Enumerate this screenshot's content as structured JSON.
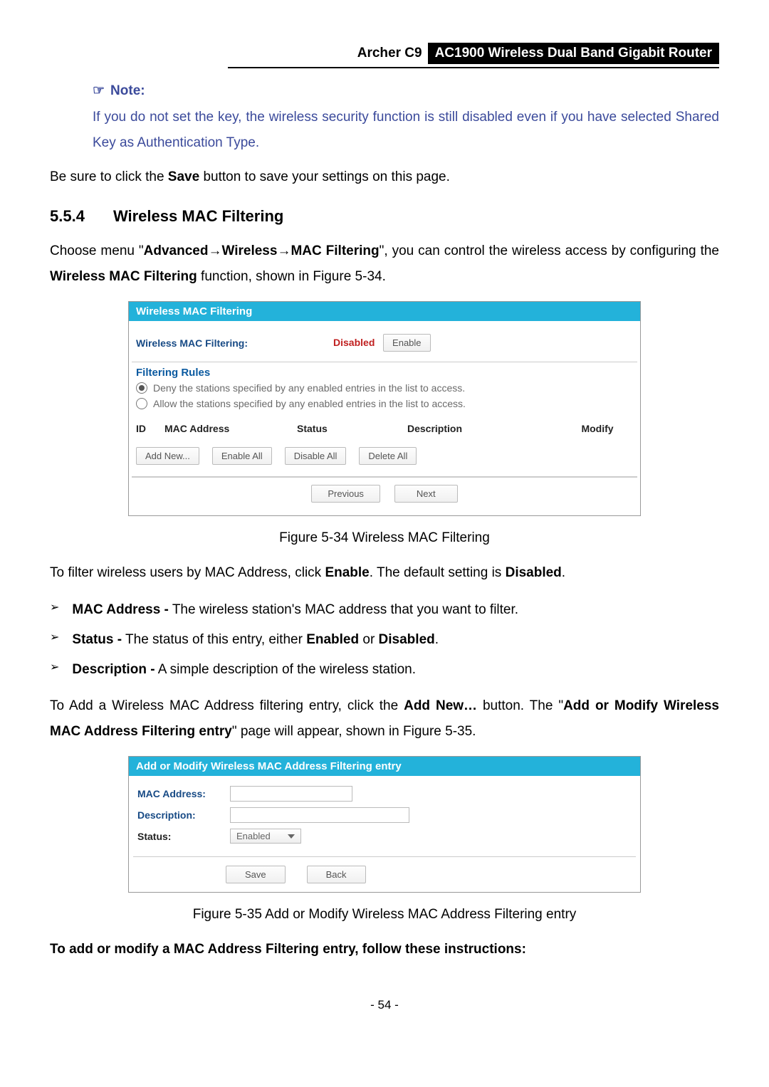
{
  "header": {
    "model": "Archer C9",
    "title_name": "AC1900 Wireless Dual Band Gigabit Router"
  },
  "note": {
    "heading": "Note:",
    "icon_glyph": "☞",
    "body": "If you do not set the key, the wireless security function is still disabled even if you have selected Shared Key as Authentication Type."
  },
  "save_line_prefix": "Be sure to click the ",
  "save_line_bold": "Save",
  "save_line_suffix": " button to save your settings on this page.",
  "section": {
    "number": "5.5.4",
    "title": "Wireless MAC Filtering"
  },
  "nav_sentence": {
    "prefix": "Choose menu \"",
    "p1": "Advanced",
    "arrow": "→",
    "p2": "Wireless",
    "p3": "MAC Filtering",
    "middle": "\", you can control the wireless access by configuring the ",
    "p4": "Wireless MAC Filtering",
    "suffix": " function, shown in Figure 5-34."
  },
  "panel1": {
    "title": "Wireless MAC Filtering",
    "state_label": "Wireless MAC Filtering:",
    "state_value": "Disabled",
    "enable_button": "Enable",
    "rules_header": "Filtering Rules",
    "rule_deny": "Deny the stations specified by any enabled entries in the list to access.",
    "rule_allow": "Allow the stations specified by any enabled entries in the list to access.",
    "table": {
      "id": "ID",
      "mac": "MAC Address",
      "status": "Status",
      "description": "Description",
      "modify": "Modify"
    },
    "buttons": {
      "add_new": "Add New...",
      "enable_all": "Enable All",
      "disable_all": "Disable All",
      "delete_all": "Delete All"
    },
    "nav": {
      "previous": "Previous",
      "next": "Next"
    }
  },
  "caption1": "Figure 5-34 Wireless MAC Filtering",
  "filter_sentence": {
    "prefix": "To filter wireless users by MAC Address, click ",
    "b1": "Enable",
    "mid": ". The default setting is ",
    "b2": "Disabled",
    "suffix": "."
  },
  "items": [
    {
      "term": "MAC Address -",
      "desc": " The wireless station's MAC address that you want to filter."
    },
    {
      "term": "Status -",
      "desc_parts": [
        " The status of this entry, either ",
        "Enabled",
        " or ",
        "Disabled",
        "."
      ]
    },
    {
      "term": "Description -",
      "desc": " A simple description of the wireless station."
    }
  ],
  "add_sentence": {
    "prefix": "To Add a Wireless MAC Address filtering entry, click the ",
    "b1": "Add New…",
    "mid1": " button. The \"",
    "b2": "Add or Modify Wireless MAC Address Filtering entry",
    "mid2": "\" page will appear, shown in Figure 5-35."
  },
  "panel2": {
    "title": "Add or Modify Wireless MAC Address Filtering entry",
    "mac_label": "MAC Address:",
    "desc_label": "Description:",
    "status_label": "Status:",
    "status_value": "Enabled",
    "buttons": {
      "save": "Save",
      "back": "Back"
    }
  },
  "caption2": "Figure 5-35 Add or Modify Wireless MAC Address Filtering entry",
  "instructions_heading": "To add or modify a MAC Address Filtering entry, follow these instructions:",
  "page_number": "- 54 -"
}
